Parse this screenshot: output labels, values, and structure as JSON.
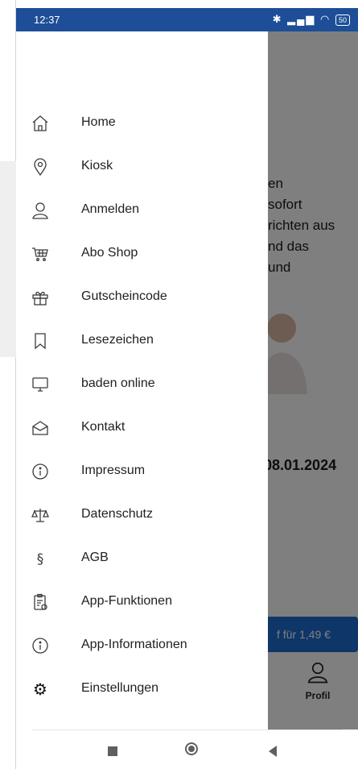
{
  "status": {
    "time": "12:37",
    "battery": "50"
  },
  "background": {
    "text_lines": [
      "en",
      "sofort",
      "richten aus",
      "nd das",
      "und"
    ],
    "date": "08.01.2024",
    "buy_button": "f für 1,49 €",
    "profile_label": "Profil"
  },
  "menu": {
    "items": [
      {
        "label": "Home",
        "icon": "home-icon"
      },
      {
        "label": "Kiosk",
        "icon": "location-pin-icon"
      },
      {
        "label": "Anmelden",
        "icon": "user-icon"
      },
      {
        "label": "Abo Shop",
        "icon": "shopping-cart-icon"
      },
      {
        "label": "Gutscheincode",
        "icon": "gift-icon"
      },
      {
        "label": "Lesezeichen",
        "icon": "bookmark-icon"
      },
      {
        "label": "baden online",
        "icon": "monitor-icon"
      },
      {
        "label": "Kontakt",
        "icon": "envelope-open-icon"
      },
      {
        "label": "Impressum",
        "icon": "info-icon"
      },
      {
        "label": "Datenschutz",
        "icon": "scales-icon"
      },
      {
        "label": "AGB",
        "icon": "section-sign-icon"
      },
      {
        "label": "App-Funktionen",
        "icon": "clipboard-icon"
      },
      {
        "label": "App-Informationen",
        "icon": "info-icon"
      },
      {
        "label": "Einstellungen",
        "icon": "gear-icon"
      }
    ]
  }
}
